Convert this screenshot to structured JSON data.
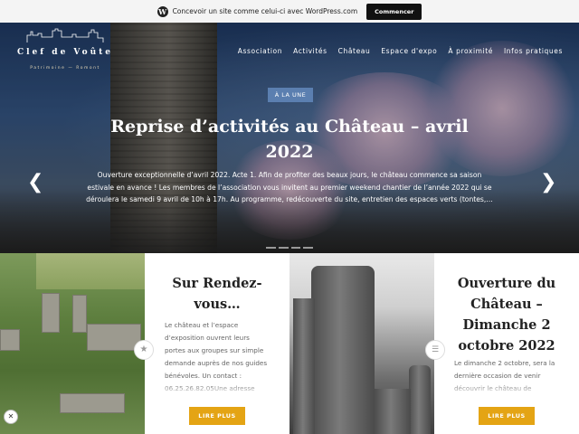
{
  "wp_bar": {
    "logo_icon": "wordpress-logo-icon",
    "logo_glyph": "W",
    "text": "Concevoir un site comme celui-ci avec WordPress.com",
    "button": "Commencer"
  },
  "site": {
    "logo_title": "Clef de Voûte",
    "logo_subtitle": "Patrimoine — Romont"
  },
  "nav": {
    "items": [
      "Association",
      "Activités",
      "Château",
      "Espace d'expo",
      "À proximité",
      "Infos pratiques"
    ]
  },
  "hero": {
    "badge": "À LA UNE",
    "title": "Reprise d’activités au Château – avril 2022",
    "excerpt": "Ouverture exceptionnelle d’avril 2022. Acte 1. Afin de profiter des beaux jours, le château commence sa saison estivale en avance ! Les membres de l’association vous invitent au premier weekend chantier de l’année 2022 qui se déroulera le samedi 9 avril de 10h à 17h. Au programme, redécouverte du site, entretien des espaces verts (tontes,…",
    "prev_arrow": "❮",
    "next_arrow": "❯"
  },
  "cards": [
    {
      "title": "Sur Rendez-vous…",
      "text": "Le château et l’espace d’exposition ouvrent leurs portes aux groupes sur simple demande auprès de nos guides bénévoles. Un contact : 06.25.26.82.05Une adresse",
      "button": "LIRE PLUS"
    },
    {
      "title": "Ouverture du Château – Dimanche 2 octobre 2022",
      "text": "Le dimanche 2 octobre, sera la dernière occasion de venir découvrir le château de",
      "button": "LIRE PLUS"
    }
  ],
  "markers": {
    "star": "★",
    "doc": "☰",
    "close": "✕"
  }
}
